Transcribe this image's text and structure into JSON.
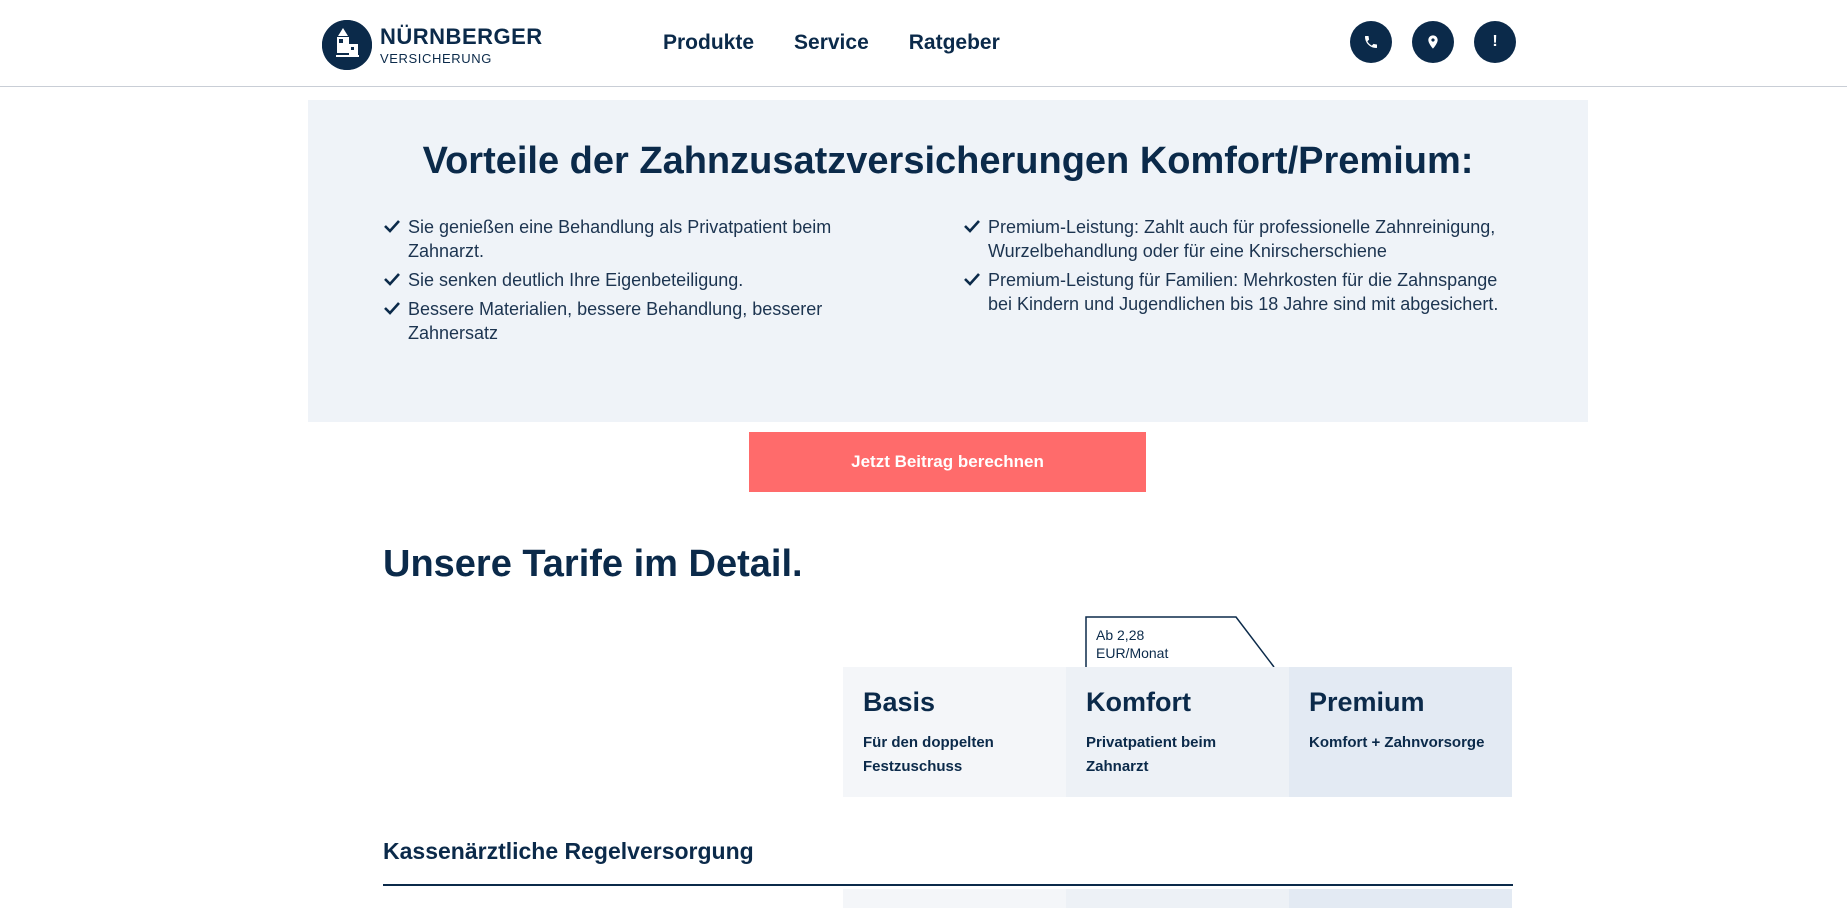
{
  "header": {
    "logo": {
      "line1": "NÜRNBERGER",
      "line2": "VERSICHERUNG"
    },
    "nav": [
      "Produkte",
      "Service",
      "Ratgeber"
    ],
    "icons": [
      "phone-icon",
      "location-pin-icon",
      "exclamation-icon"
    ],
    "icon_glyphs": {
      "exclamation": "!"
    }
  },
  "benefits": {
    "title": "Vorteile der Zahnzusatzversicherungen Komfort/Premium:",
    "left": [
      "Sie genießen eine Behandlung als Privatpatient beim Zahnarzt.",
      "Sie senken deutlich Ihre Eigenbeteiligung.",
      "Bessere Materialien, bessere Behandlung, besserer Zahnersatz"
    ],
    "right": [
      "Premium-Leistung: Zahlt auch für professionelle Zahnreinigung, Wurzelbehandlung oder für eine Knirscherschiene",
      "Premium-Leistung für Familien: Mehrkosten für die Zahnspange bei Kindern und Jugendlichen bis 18 Jahre sind mit abgesichert."
    ]
  },
  "cta": {
    "label": "Jetzt Beitrag berechnen"
  },
  "tarife": {
    "title": "Unsere Tarife im Detail.",
    "price_tag": {
      "line1": "Ab 2,28",
      "line2": "EUR/Monat"
    },
    "cards": [
      {
        "name": "Basis",
        "desc": "Für den doppelten Festzuschuss"
      },
      {
        "name": "Komfort",
        "desc": "Privatpatient beim Zahnarzt"
      },
      {
        "name": "Premium",
        "desc": "Komfort + Zahnvorsorge"
      }
    ],
    "row_title": "Kassenärztliche Regelversorgung"
  },
  "colors": {
    "navy": "#0b2a4a",
    "cta": "#ff6b6b",
    "panel": "#eff3f8"
  }
}
